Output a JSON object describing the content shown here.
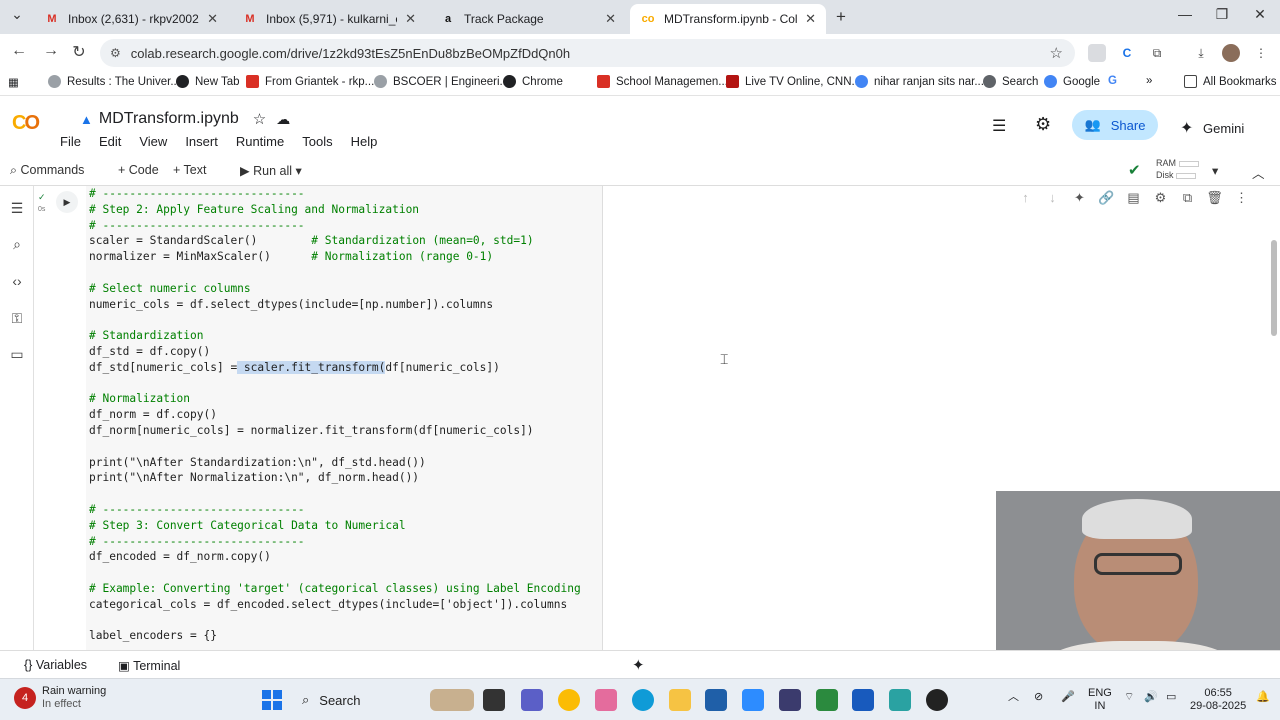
{
  "browser": {
    "tabs": [
      {
        "title": "Inbox (2,631) - rkpv2002@gma",
        "active": false
      },
      {
        "title": "Inbox (5,971) - kulkarni_cse@m",
        "active": false
      },
      {
        "title": "Track Package",
        "active": false
      },
      {
        "title": "MDTransform.ipynb - Colab",
        "active": true
      }
    ],
    "url": "colab.research.google.com/drive/1z2kd93tEsZ5nEnDu8bzBeOMpZfDdQn0h",
    "bookmarks": [
      "Results : The Univer...",
      "New Tab",
      "From Griantek - rkp...",
      "BSCOER | Engineeri...",
      "Chrome",
      "School Managemen...",
      "Live TV Online, CNN...",
      "nihar ranjan sits nar...",
      "Search",
      "Google",
      "All Bookmarks"
    ]
  },
  "colab": {
    "notebook_title": "MDTransform.ipynb",
    "menus": [
      "File",
      "Edit",
      "View",
      "Insert",
      "Runtime",
      "Tools",
      "Help"
    ],
    "share_label": "Share",
    "gemini_label": "Gemini",
    "toolbar": {
      "commands": "Commands",
      "code": "+ Code",
      "text": "+ Text",
      "run_all": "Run all"
    },
    "ram_label": "RAM",
    "disk_label": "Disk",
    "cell_exec": "0s"
  },
  "code_lines": [
    {
      "t": "# ------------------------------",
      "k": "cm"
    },
    {
      "t": "# Step 2: Apply Feature Scaling and Normalization",
      "k": "cm"
    },
    {
      "t": "# ------------------------------",
      "k": "cm"
    },
    {
      "t": "scaler = StandardScaler()        # Standardization (mean=0, std=1)",
      "k": ""
    },
    {
      "t": "normalizer = MinMaxScaler()      # Normalization (range 0-1)",
      "k": ""
    },
    {
      "t": "",
      "k": ""
    },
    {
      "t": "# Select numeric columns",
      "k": "cm"
    },
    {
      "t": "numeric_cols = df.select_dtypes(include=[np.number]).columns",
      "k": ""
    },
    {
      "t": "",
      "k": ""
    },
    {
      "t": "# Standardization",
      "k": "cm"
    },
    {
      "t": "df_std = df.copy()",
      "k": ""
    },
    {
      "t": "df_std[numeric_cols] = scaler.fit_transform(df[numeric_cols])",
      "k": "hl"
    },
    {
      "t": "",
      "k": ""
    },
    {
      "t": "# Normalization",
      "k": "cm"
    },
    {
      "t": "df_norm = df.copy()",
      "k": ""
    },
    {
      "t": "df_norm[numeric_cols] = normalizer.fit_transform(df[numeric_cols])",
      "k": ""
    },
    {
      "t": "",
      "k": ""
    },
    {
      "t": "print(\"\\nAfter Standardization:\\n\", df_std.head())",
      "k": ""
    },
    {
      "t": "print(\"\\nAfter Normalization:\\n\", df_norm.head())",
      "k": ""
    },
    {
      "t": "",
      "k": ""
    },
    {
      "t": "# ------------------------------",
      "k": "cm"
    },
    {
      "t": "# Step 3: Convert Categorical Data to Numerical",
      "k": "cm"
    },
    {
      "t": "# ------------------------------",
      "k": "cm"
    },
    {
      "t": "df_encoded = df_norm.copy()",
      "k": ""
    },
    {
      "t": "",
      "k": ""
    },
    {
      "t": "# Example: Converting 'target' (categorical classes) using Label Encoding",
      "k": "cm"
    },
    {
      "t": "categorical_cols = df_encoded.select_dtypes(include=['object']).columns",
      "k": ""
    },
    {
      "t": "",
      "k": ""
    },
    {
      "t": "label_encoders = {}",
      "k": ""
    }
  ],
  "bottom": {
    "variables": "Variables",
    "terminal": "Terminal"
  },
  "taskbar": {
    "weather_title": "Rain warning",
    "weather_sub": "In effect",
    "search": "Search",
    "lang1": "ENG",
    "lang2": "IN",
    "time": "06:55",
    "date": "29-08-2025"
  }
}
